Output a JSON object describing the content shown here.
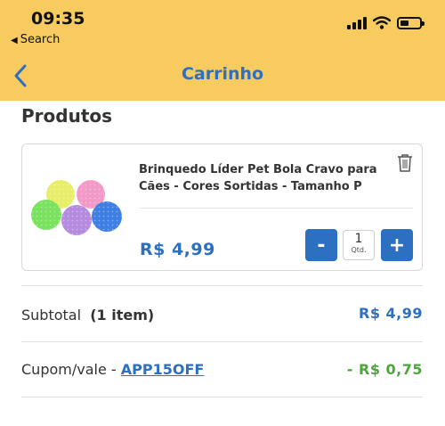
{
  "status_bar": {
    "time": "09:35",
    "back_app_label": "Search"
  },
  "nav": {
    "title": "Carrinho"
  },
  "products_section": {
    "title": "Produtos",
    "items": [
      {
        "name": "Brinquedo Líder Pet Bola Cravo para Cães - Cores Sortidas - Tamanho P",
        "price": "R$  4,99",
        "quantity": "1",
        "quantity_label": "Qtd.",
        "decrease_label": "-",
        "increase_label": "+"
      }
    ]
  },
  "summary": {
    "subtotal_label": "Subtotal",
    "subtotal_count": "(1 item)",
    "subtotal_value": "R$  4,99",
    "coupon_label": "Cupom/vale - ",
    "coupon_code": "APP15OFF",
    "coupon_value": "- R$   0,75"
  },
  "colors": {
    "header_bg": "#f7cb5f",
    "accent_blue": "#2d6fc1",
    "discount_green": "#4ca63b"
  },
  "icons": [
    "signal-icon",
    "wifi-icon",
    "battery-icon",
    "back-chevron-icon",
    "trash-icon"
  ]
}
